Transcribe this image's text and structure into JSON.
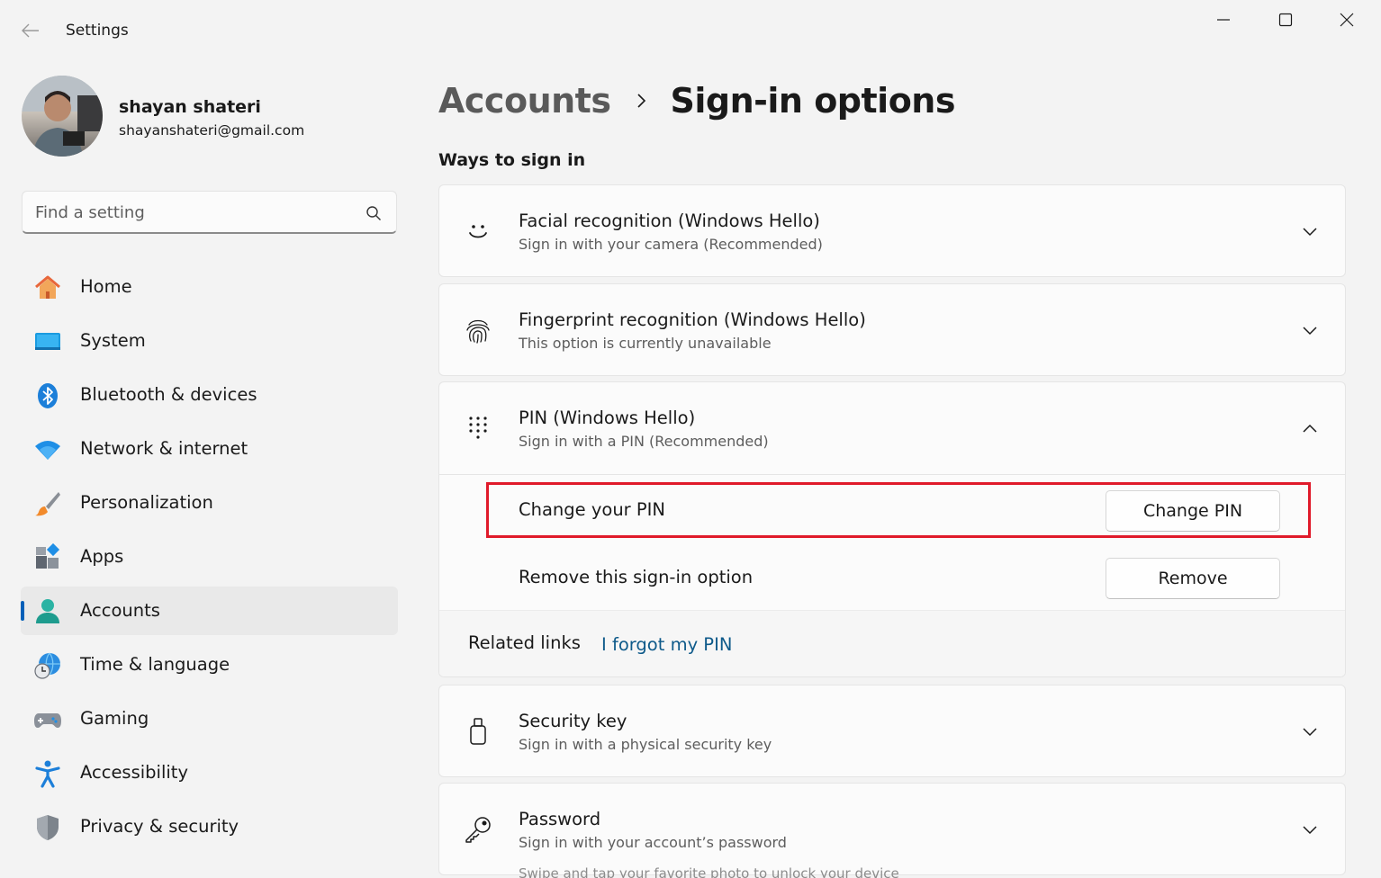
{
  "window": {
    "app_title": "Settings"
  },
  "profile": {
    "name": "shayan shateri",
    "email": "shayanshateri@gmail.com"
  },
  "search": {
    "placeholder": "Find a setting"
  },
  "sidebar": {
    "items": [
      {
        "label": "Home",
        "icon": "home-icon"
      },
      {
        "label": "System",
        "icon": "system-icon"
      },
      {
        "label": "Bluetooth & devices",
        "icon": "bluetooth-icon"
      },
      {
        "label": "Network & internet",
        "icon": "wifi-icon"
      },
      {
        "label": "Personalization",
        "icon": "brush-icon"
      },
      {
        "label": "Apps",
        "icon": "apps-icon"
      },
      {
        "label": "Accounts",
        "icon": "person-icon",
        "active": true
      },
      {
        "label": "Time & language",
        "icon": "globe-clock-icon"
      },
      {
        "label": "Gaming",
        "icon": "gamepad-icon"
      },
      {
        "label": "Accessibility",
        "icon": "accessibility-icon"
      },
      {
        "label": "Privacy & security",
        "icon": "shield-icon"
      }
    ]
  },
  "breadcrumb": {
    "parent": "Accounts",
    "current": "Sign-in options"
  },
  "main": {
    "section_title": "Ways to sign in",
    "options": [
      {
        "title": "Facial recognition (Windows Hello)",
        "subtitle": "Sign in with your camera (Recommended)",
        "icon": "face-icon",
        "expanded": false
      },
      {
        "title": "Fingerprint recognition (Windows Hello)",
        "subtitle": "This option is currently unavailable",
        "icon": "fingerprint-icon",
        "expanded": false
      },
      {
        "title": "PIN (Windows Hello)",
        "subtitle": "Sign in with a PIN (Recommended)",
        "icon": "pin-keypad-icon",
        "expanded": true
      },
      {
        "title": "Security key",
        "subtitle": "Sign in with a physical security key",
        "icon": "usb-key-icon",
        "expanded": false
      },
      {
        "title": "Password",
        "subtitle": "Sign in with your account’s password",
        "icon": "key-icon",
        "expanded": false
      }
    ],
    "pin": {
      "change_label": "Change your PIN",
      "change_button": "Change PIN",
      "remove_label": "Remove this sign-in option",
      "remove_button": "Remove",
      "related_label": "Related links",
      "forgot_link": "I forgot my PIN"
    },
    "peek_text": "Swipe and tap your favorite photo to unlock your device"
  },
  "colors": {
    "accent": "#005fb8",
    "highlight": "#e01a2a",
    "link": "#0e5a8a"
  }
}
